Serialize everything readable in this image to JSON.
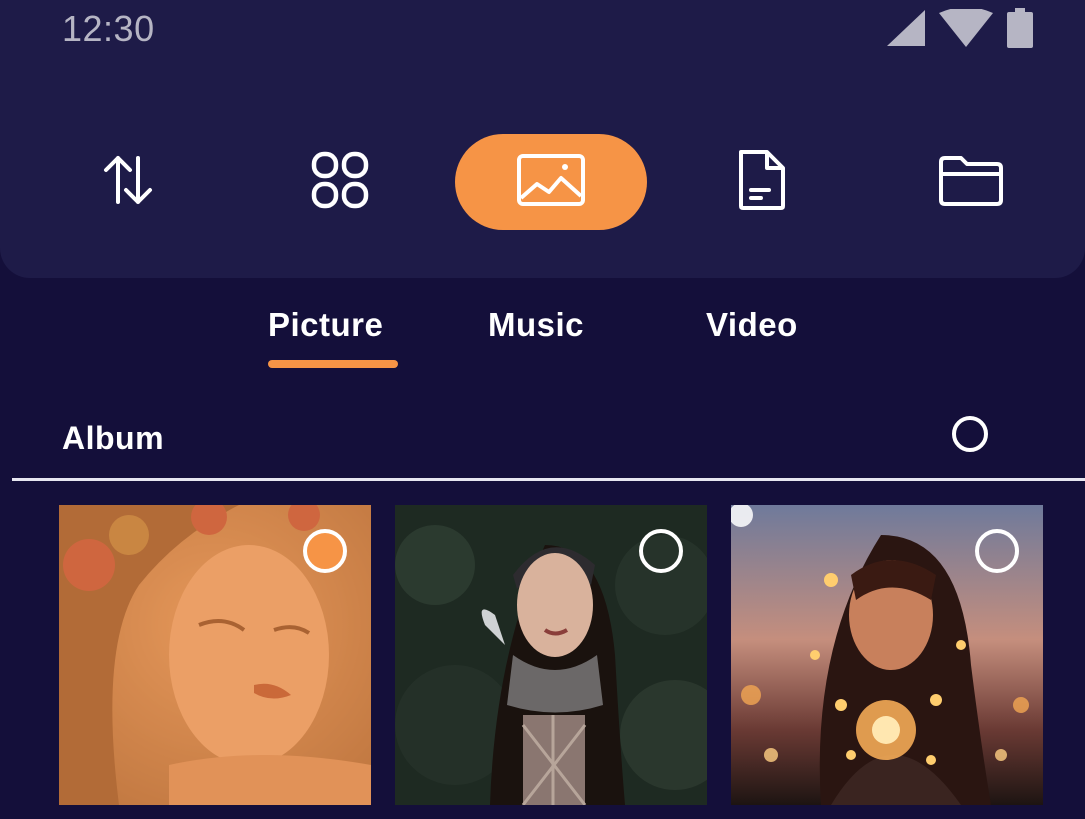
{
  "status_bar": {
    "time": "12:30",
    "icons": [
      "signal-icon",
      "wifi-icon",
      "battery-icon"
    ]
  },
  "nav": {
    "items": [
      {
        "name": "transfer",
        "icon": "swap-arrows-icon",
        "active": false
      },
      {
        "name": "apps",
        "icon": "grid-icon",
        "active": false
      },
      {
        "name": "pictures",
        "icon": "image-icon",
        "active": true
      },
      {
        "name": "documents",
        "icon": "document-icon",
        "active": false
      },
      {
        "name": "folders",
        "icon": "folder-icon",
        "active": false
      }
    ]
  },
  "tabs": {
    "items": [
      {
        "label": "Picture",
        "active": true
      },
      {
        "label": "Music",
        "active": false
      },
      {
        "label": "Video",
        "active": false
      }
    ]
  },
  "section": {
    "title": "Album"
  },
  "album": {
    "items": [
      {
        "description_icon": "photo-thumbnail",
        "selected": true
      },
      {
        "description_icon": "photo-thumbnail",
        "selected": false
      },
      {
        "description_icon": "photo-thumbnail",
        "selected": false
      }
    ]
  },
  "colors": {
    "accent": "#f69446",
    "panel": "#1e1b48",
    "background": "#140f3a",
    "text": "#ffffff"
  }
}
